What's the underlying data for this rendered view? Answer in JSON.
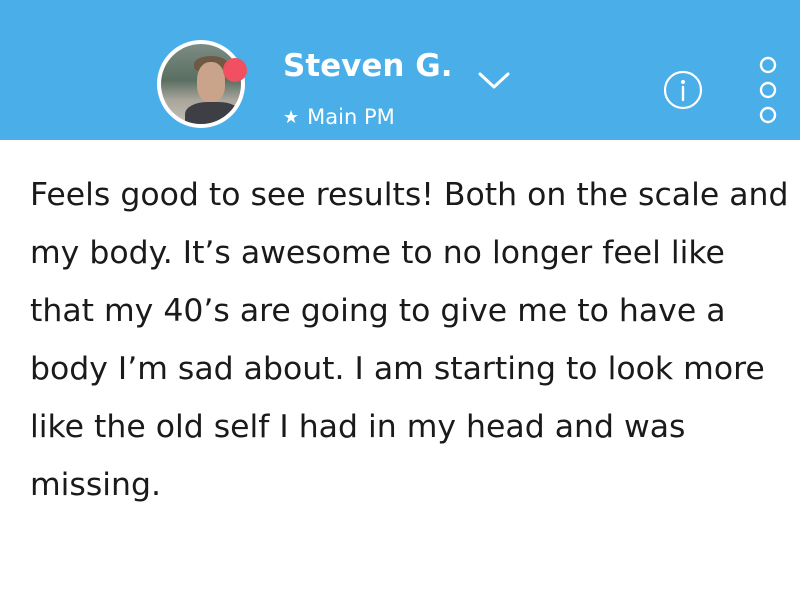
{
  "header": {
    "name": "Steven G.",
    "subtitle_star": "★",
    "subtitle": "Main PM",
    "avatar_alt": "profile photo",
    "icons": {
      "dropdown": "chevron-down-icon",
      "info": "info-icon",
      "more": "more-vertical-icon",
      "status": "status-dot"
    },
    "colors": {
      "bar": "#4aaee8",
      "status_dot": "#f0505f",
      "text": "#ffffff"
    }
  },
  "message": {
    "text": "Feels good to see results! Both on the scale and my body. It’s awesome to no longer feel like that my 40’s are going to give me to have a body I’m sad about. I am starting to look more like the old self I had in my head and was missing."
  }
}
